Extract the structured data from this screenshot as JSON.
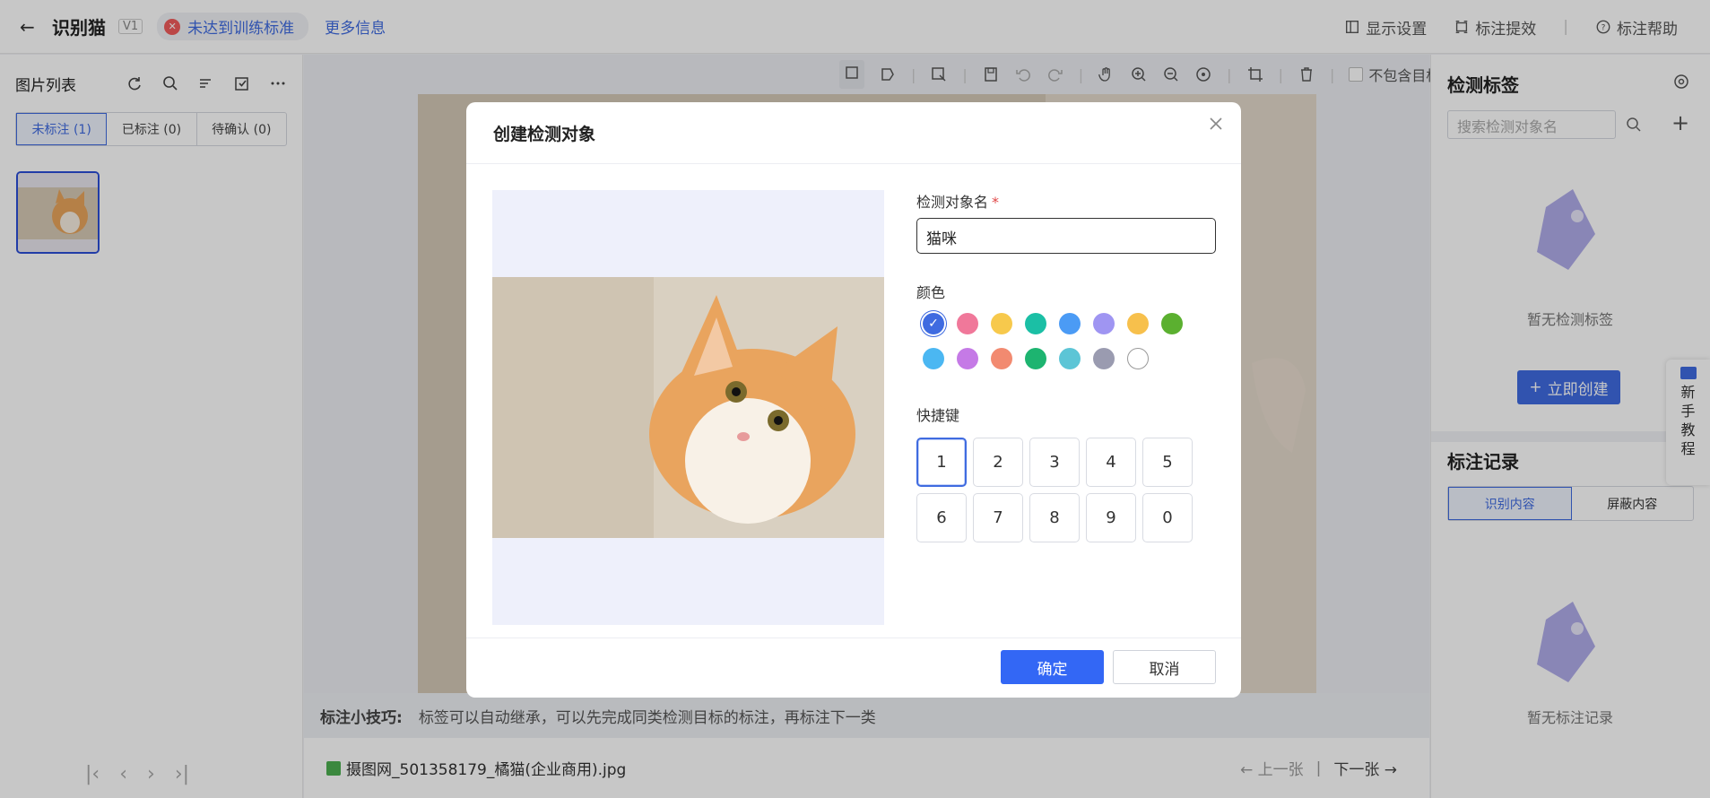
{
  "topbar": {
    "title": "识别猫",
    "version": "V1",
    "status_text": "未达到训练标准",
    "more_info": "更多信息",
    "display_settings": "显示设置",
    "efficiency": "标注提效",
    "help": "标注帮助"
  },
  "left": {
    "title": "图片列表",
    "tabs": [
      {
        "label": "未标注 (1)",
        "active": true
      },
      {
        "label": "已标注 (0)",
        "active": false
      },
      {
        "label": "待确认 (0)",
        "active": false
      }
    ]
  },
  "toolbar": {
    "exclude_target": "不包含目标"
  },
  "tip": {
    "label": "标注小技巧:",
    "text": "标签可以自动继承，可以先完成同类检测目标的标注，再标注下一类"
  },
  "file": {
    "name": "摄图网_501358179_橘猫(企业商用).jpg",
    "prev": "上一张",
    "separator": "|",
    "next": "下一张"
  },
  "right": {
    "title": "检测标签",
    "search_placeholder": "搜索检测对象名",
    "empty_labels": "暂无检测标签",
    "create_now": "立即创建",
    "record_title": "标注记录",
    "record_tabs": [
      {
        "label": "识别内容",
        "active": true
      },
      {
        "label": "屏蔽内容",
        "active": false
      }
    ],
    "empty_records": "暂无标注记录"
  },
  "tutorial": {
    "chars": [
      "新",
      "手",
      "教",
      "程"
    ]
  },
  "modal": {
    "title": "创建检测对象",
    "name_label": "检测对象名",
    "required_mark": "*",
    "name_value": "猫咪",
    "color_label": "颜色",
    "colors": [
      "#3f6be0",
      "#f0789a",
      "#f7c94c",
      "#1bbfa5",
      "#4b9bf5",
      "#9f95f2",
      "#f7c04c",
      "#5bb030",
      "#4bb7f2",
      "#c57ae6",
      "#f28a70",
      "#1db470",
      "#5cc5d6",
      "#9a9bb0",
      "#ffffff"
    ],
    "selected_color_index": 0,
    "shortcut_label": "快捷键",
    "keys": [
      "1",
      "2",
      "3",
      "4",
      "5",
      "6",
      "7",
      "8",
      "9",
      "0"
    ],
    "selected_key_index": 0,
    "confirm": "确定",
    "cancel": "取消"
  }
}
